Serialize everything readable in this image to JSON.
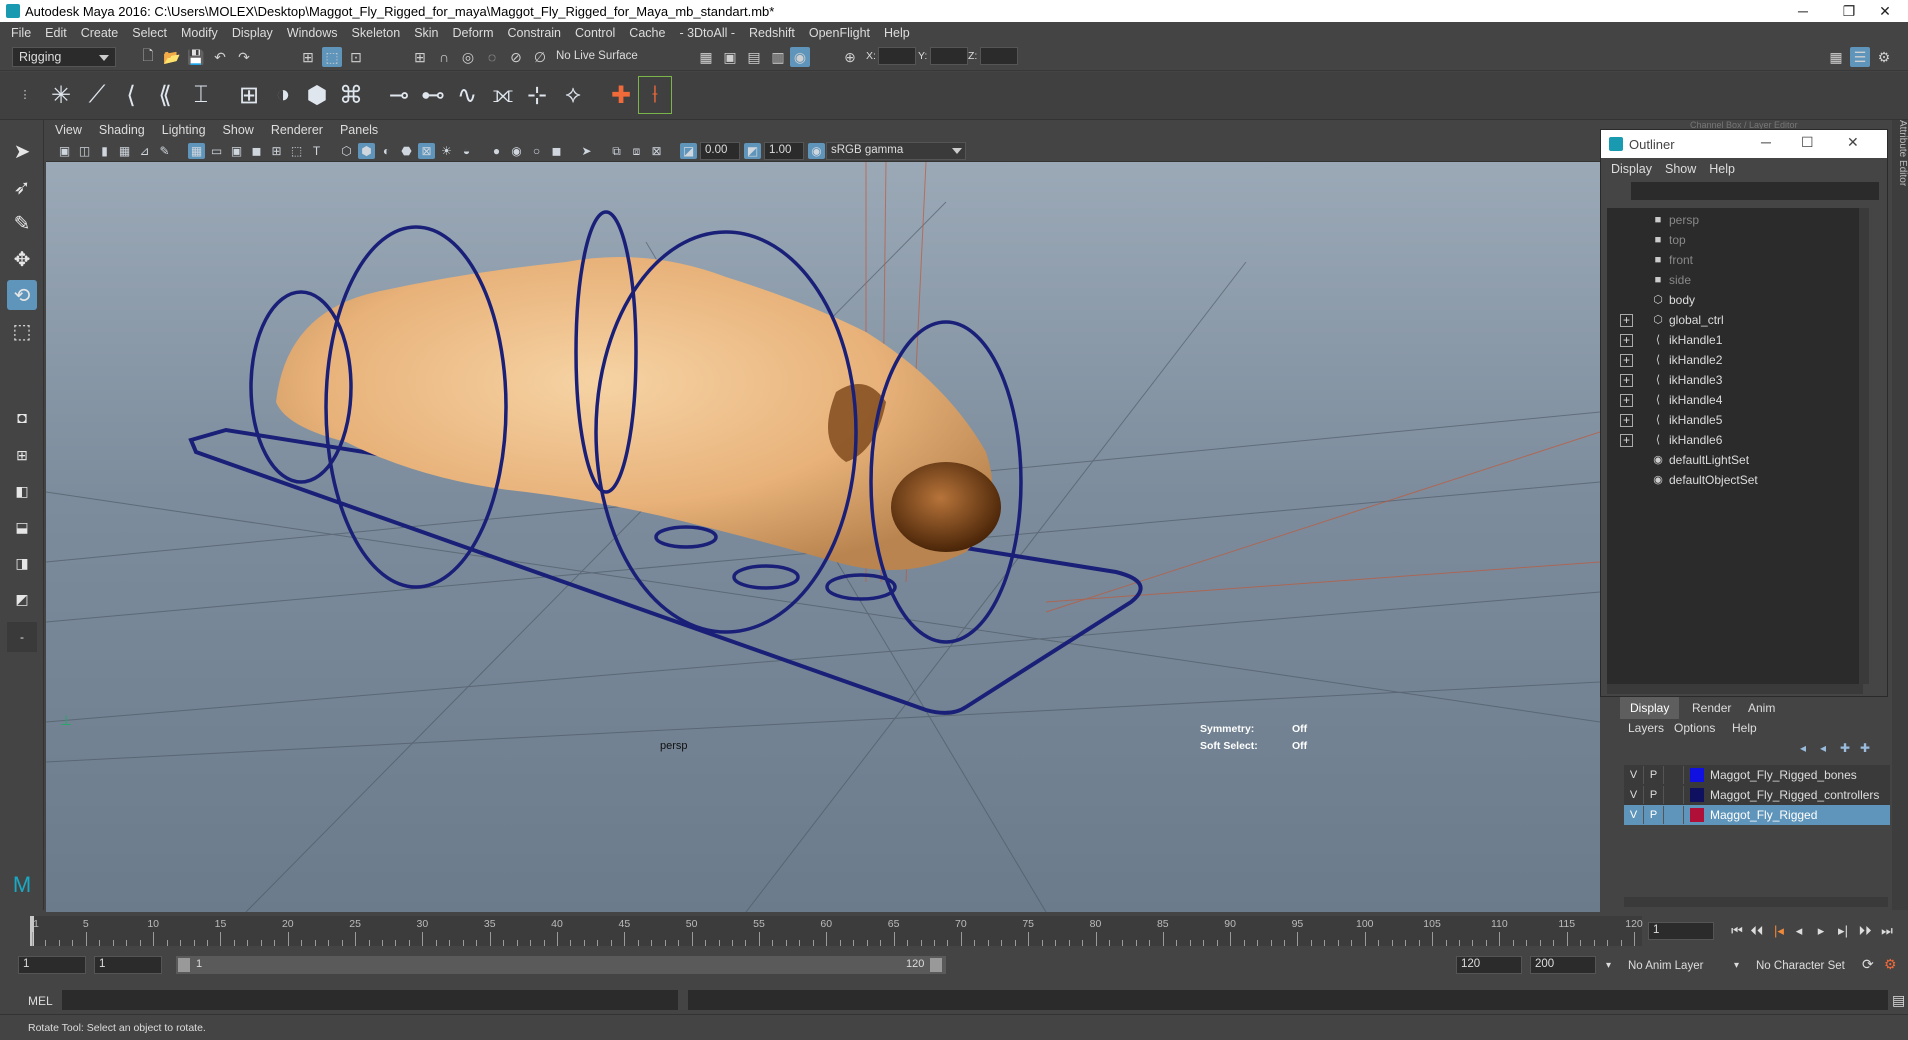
{
  "window": {
    "title": "Autodesk Maya 2016: C:\\Users\\MOLEX\\Desktop\\Maggot_Fly_Rigged_for_maya\\Maggot_Fly_Rigged_for_Maya_mb_standart.mb*",
    "minimize": "─",
    "restore": "❐",
    "close": "✕"
  },
  "menubar": [
    "File",
    "Edit",
    "Create",
    "Select",
    "Modify",
    "Display",
    "Windows",
    "Skeleton",
    "Skin",
    "Deform",
    "Constrain",
    "Control",
    "Cache",
    "- 3DtoAll -",
    "Redshift",
    "OpenFlight",
    "Help"
  ],
  "statusline": {
    "mode": "Rigging",
    "live_surface": "No Live Surface",
    "x_label": "X:",
    "y_label": "Y:",
    "z_label": "Z:"
  },
  "viewport_menu": [
    "View",
    "Shading",
    "Lighting",
    "Show",
    "Renderer",
    "Panels"
  ],
  "viewport_toolbar": {
    "exposure": "0.00",
    "gamma": "1.00",
    "color_space": "sRGB gamma"
  },
  "viewport": {
    "camera_label": "persp",
    "symmetry_label": "Symmetry:",
    "symmetry_value": "Off",
    "soft_select_label": "Soft Select:",
    "soft_select_value": "Off"
  },
  "outliner": {
    "title": "Outliner",
    "menu": [
      "Display",
      "Show",
      "Help"
    ],
    "behind_title": "Channel Box / Layer Editor",
    "items": [
      {
        "label": "persp",
        "icon": "camera-icon",
        "expandable": false,
        "dim": true
      },
      {
        "label": "top",
        "icon": "camera-icon",
        "expandable": false,
        "dim": true
      },
      {
        "label": "front",
        "icon": "camera-icon",
        "expandable": false,
        "dim": true
      },
      {
        "label": "side",
        "icon": "camera-icon",
        "expandable": false,
        "dim": true
      },
      {
        "label": "body",
        "icon": "mesh-icon",
        "expandable": false,
        "dim": false
      },
      {
        "label": "global_ctrl",
        "icon": "curve-icon",
        "expandable": true,
        "dim": false
      },
      {
        "label": "ikHandle1",
        "icon": "ik-handle-icon",
        "expandable": true,
        "dim": false
      },
      {
        "label": "ikHandle2",
        "icon": "ik-handle-icon",
        "expandable": true,
        "dim": false
      },
      {
        "label": "ikHandle3",
        "icon": "ik-handle-icon",
        "expandable": true,
        "dim": false
      },
      {
        "label": "ikHandle4",
        "icon": "ik-handle-icon",
        "expandable": true,
        "dim": false
      },
      {
        "label": "ikHandle5",
        "icon": "ik-handle-icon",
        "expandable": true,
        "dim": false
      },
      {
        "label": "ikHandle6",
        "icon": "ik-handle-icon",
        "expandable": true,
        "dim": false
      },
      {
        "label": "defaultLightSet",
        "icon": "set-icon",
        "expandable": false,
        "dim": false
      },
      {
        "label": "defaultObjectSet",
        "icon": "set-icon",
        "expandable": false,
        "dim": false
      }
    ]
  },
  "layer_editor": {
    "tabs": [
      "Display",
      "Render",
      "Anim"
    ],
    "menu": [
      "Layers",
      "Options",
      "Help"
    ],
    "layers": [
      {
        "v": "V",
        "p": "P",
        "name": "Maggot_Fly_Rigged_bones",
        "color": "#1010e0",
        "selected": false
      },
      {
        "v": "V",
        "p": "P",
        "name": "Maggot_Fly_Rigged_controllers",
        "color": "#101060",
        "selected": false
      },
      {
        "v": "V",
        "p": "P",
        "name": "Maggot_Fly_Rigged",
        "color": "#b01038",
        "selected": true
      }
    ]
  },
  "right_strip_text": "Attribute Editor",
  "timeline": {
    "ticks": [
      "1",
      "5",
      "10",
      "15",
      "20",
      "25",
      "30",
      "35",
      "40",
      "45",
      "50",
      "55",
      "60",
      "65",
      "70",
      "75",
      "80",
      "85",
      "90",
      "95",
      "100",
      "105",
      "110",
      "115",
      "120"
    ],
    "current_frame": "1",
    "playback_buttons": [
      "⏮",
      "⏴⏴",
      "|◂",
      "◂",
      "▸",
      "▸|",
      "⏵⏵",
      "⏭"
    ]
  },
  "range": {
    "start": "1",
    "playback_start": "1",
    "slider_start": "1",
    "slider_end": "120",
    "playback_end": "120",
    "end": "200",
    "anim_layer": "No Anim Layer",
    "character_set": "No Character Set"
  },
  "command_line": {
    "label": "MEL"
  },
  "help_line": "Rotate Tool: Select an object to rotate."
}
